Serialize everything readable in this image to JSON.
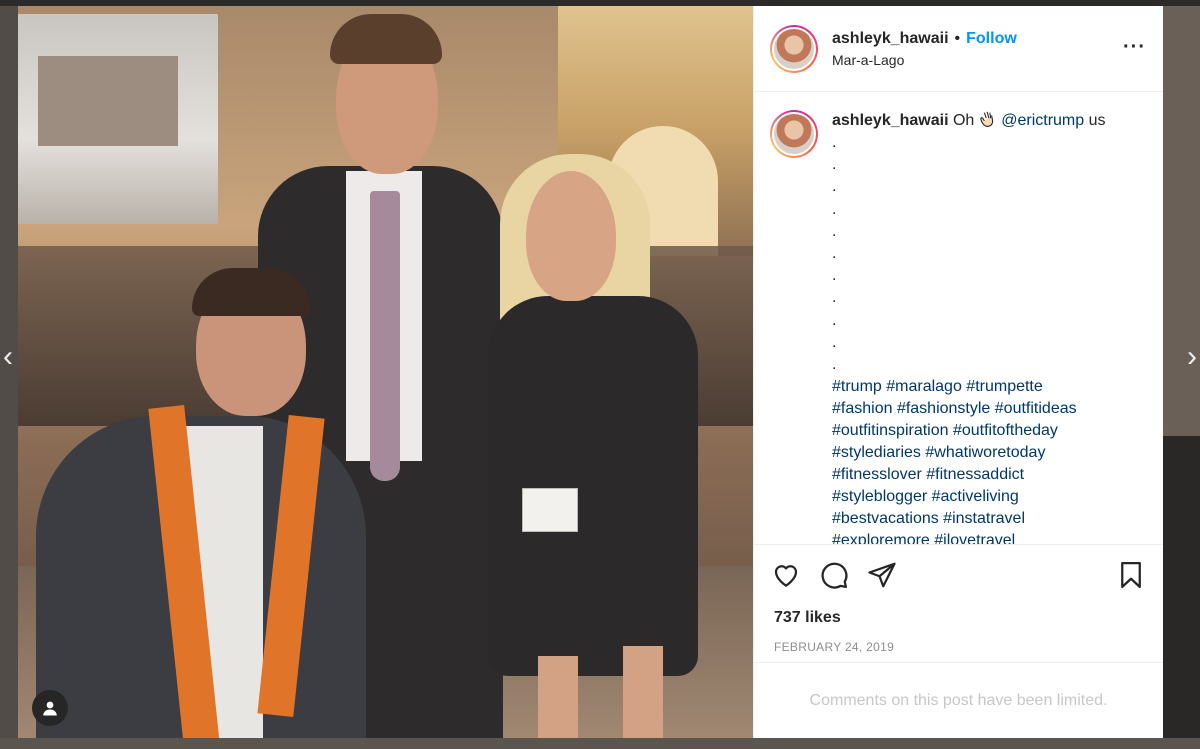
{
  "post": {
    "username": "ashleyk_hawaii",
    "follow_label": "Follow",
    "separator": "•",
    "location": "Mar-a-Lago",
    "more_icon": "more-horizontal-icon",
    "caption": {
      "username": "ashleyk_hawaii",
      "text_before": "Oh",
      "emoji": "waving-hand-icon",
      "mention": "@erictrump",
      "text_after": "us",
      "dots": [
        ".",
        ".",
        ".",
        ".",
        ".",
        ".",
        ".",
        ".",
        ".",
        ".",
        "."
      ],
      "hashtag_lines": [
        "#trump #maralago #trumpette",
        "#fashion #fashionstyle #outfitideas",
        "#outfitinspiration #outfitoftheday",
        "#stylediaries #whatiworetoday",
        "#fitnesslover #fitnessaddict",
        "#styleblogger #activeliving",
        "#bestvacations #instatravel",
        "#exploremore #ilovetravel"
      ]
    },
    "likes": "737 likes",
    "date": "FEBRUARY 24, 2019",
    "comments_notice": "Comments on this post have been limited."
  },
  "colors": {
    "follow": "#0095f6",
    "link": "#00376b",
    "muted": "#8e8e8e"
  }
}
